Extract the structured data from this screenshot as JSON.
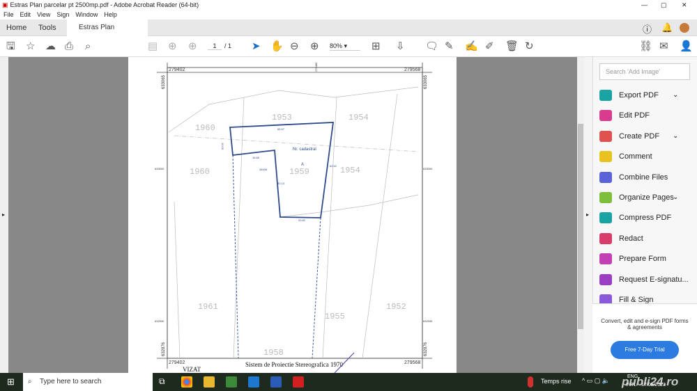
{
  "window": {
    "title": "Estras Plan parcelar pt 2500mp.pdf - Adobe Acrobat Reader (64-bit)",
    "controls": [
      "minimize",
      "maximize",
      "close"
    ]
  },
  "menu": [
    "File",
    "Edit",
    "View",
    "Sign",
    "Window",
    "Help"
  ],
  "tabs": {
    "home": "Home",
    "tools": "Tools",
    "document": "Estras Plan parcelar...",
    "close": "×"
  },
  "toolbar": {
    "page_current": "1",
    "page_total": "/ 1",
    "zoom": "80%"
  },
  "map": {
    "coords": {
      "top_left_x": "279402",
      "top_right_x": "279568",
      "bottom_left_x": "279402",
      "bottom_right_x": "279568",
      "left_top_y": "633065",
      "right_top_y": "633065",
      "left_bottom_y": "632876",
      "right_bottom_y": "632876",
      "mid_top": "279485",
      "mid_left": "633000",
      "mid_right": "633000",
      "low_left": "632930",
      "low_right": "632930"
    },
    "parcels": [
      "1953",
      "1954",
      "1960",
      "1960",
      "1959",
      "1954",
      "1961",
      "1955",
      "1952",
      "1958"
    ],
    "cadastral_label": "Nr. cadastral",
    "point_label": "A",
    "dimensions": [
      "65.57",
      "10.00",
      "16.65",
      "30.13",
      "62.62",
      "20.82"
    ],
    "area": "34008",
    "footer": "Sistem de Proiectie Stereografica 1970",
    "stamp": "VIZAT"
  },
  "right_panel": {
    "search_placeholder": "Search 'Add Image'",
    "tools": [
      {
        "label": "Export PDF",
        "color": "#1aa3a3",
        "expand": true
      },
      {
        "label": "Edit PDF",
        "color": "#d83c8f",
        "expand": false
      },
      {
        "label": "Create PDF",
        "color": "#e0524f",
        "expand": true
      },
      {
        "label": "Comment",
        "color": "#e8c21e",
        "expand": false
      },
      {
        "label": "Combine Files",
        "color": "#5a63d8",
        "expand": false
      },
      {
        "label": "Organize Pages",
        "color": "#7cbf3c",
        "expand": true
      },
      {
        "label": "Compress PDF",
        "color": "#1aa3a3",
        "expand": false
      },
      {
        "label": "Redact",
        "color": "#d83c6a",
        "expand": false
      },
      {
        "label": "Prepare Form",
        "color": "#c23fb4",
        "expand": false
      },
      {
        "label": "Request E-signatu...",
        "color": "#9b3fc2",
        "expand": false
      },
      {
        "label": "Fill & Sign",
        "color": "#8a5bd8",
        "expand": false
      }
    ],
    "promo": "Convert, edit and e-sign PDF forms & agreements",
    "trial_button": "Free 7-Day Trial",
    "accent": "#2b7be0"
  },
  "taskbar": {
    "search_placeholder": "Type here to search",
    "weather": "Temps rise",
    "lang": "ENG",
    "lang2": "INTL",
    "date": "17/05/2023",
    "watermark": "publi24.ro"
  }
}
